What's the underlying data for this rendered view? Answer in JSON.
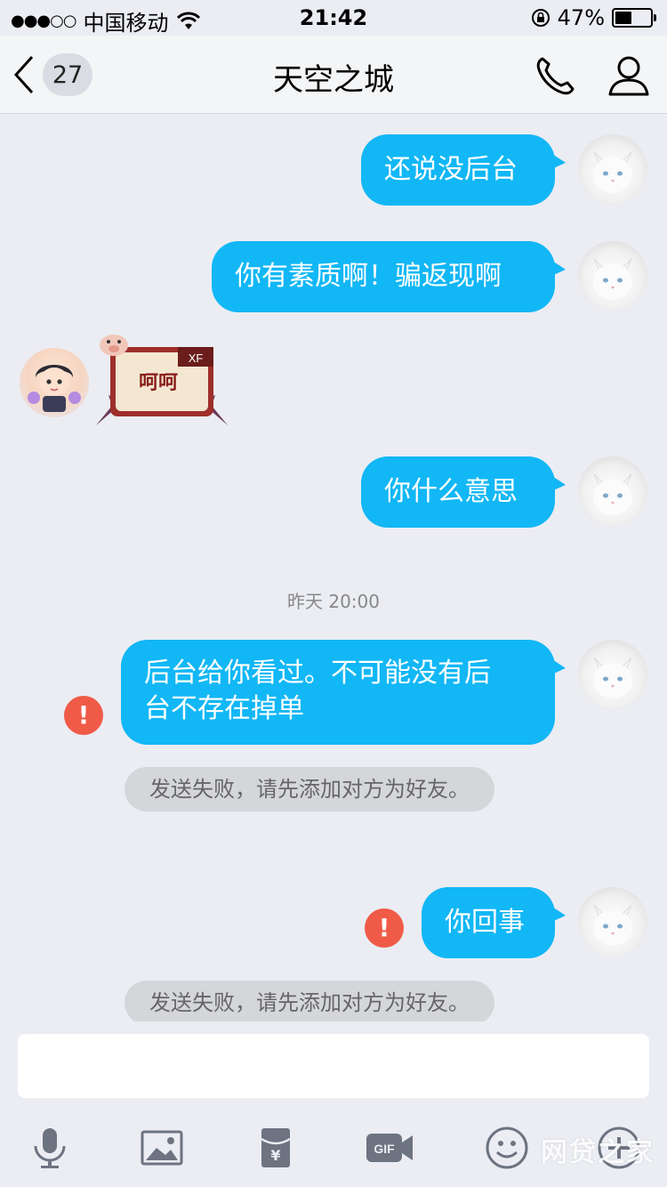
{
  "status_bar": {
    "signal": "●●●○○",
    "carrier": "中国移动",
    "time": "21:42",
    "battery": "47%",
    "battery_level": 0.47
  },
  "nav": {
    "unread_count": "27",
    "title": "天空之城"
  },
  "messages": [
    {
      "side": "right",
      "text": "还说没后台"
    },
    {
      "side": "right",
      "text": "你有素质啊！骗返现啊"
    },
    {
      "side": "left",
      "sticker_text": "呵呵",
      "sticker_badge": "XF"
    },
    {
      "side": "right",
      "text": "你什么意思"
    },
    {
      "side": "right",
      "text": "后台给你看过。不可能没有后台不存在掉单",
      "line1": "后台给你看过。不可能没有后",
      "line2": "台不存在掉单",
      "failed": true
    },
    {
      "side": "right",
      "text": "你回事",
      "failed": true
    }
  ],
  "timestamp": "昨天 20:00",
  "system_notices": [
    "发送失败，请先添加对方为好友。",
    "发送失败，请先添加对方为好友。"
  ],
  "error_mark": "!",
  "input": {
    "value": "",
    "placeholder": ""
  },
  "toolbar": [
    "microphone-icon",
    "image-icon",
    "red-packet-icon",
    "gif-icon",
    "emoji-icon",
    "plus-icon"
  ],
  "watermark": "网贷之家",
  "colors": {
    "bubble": "#12b7f5",
    "background": "#ebedf3",
    "error": "#f05b48",
    "pill": "#d4d6da"
  }
}
